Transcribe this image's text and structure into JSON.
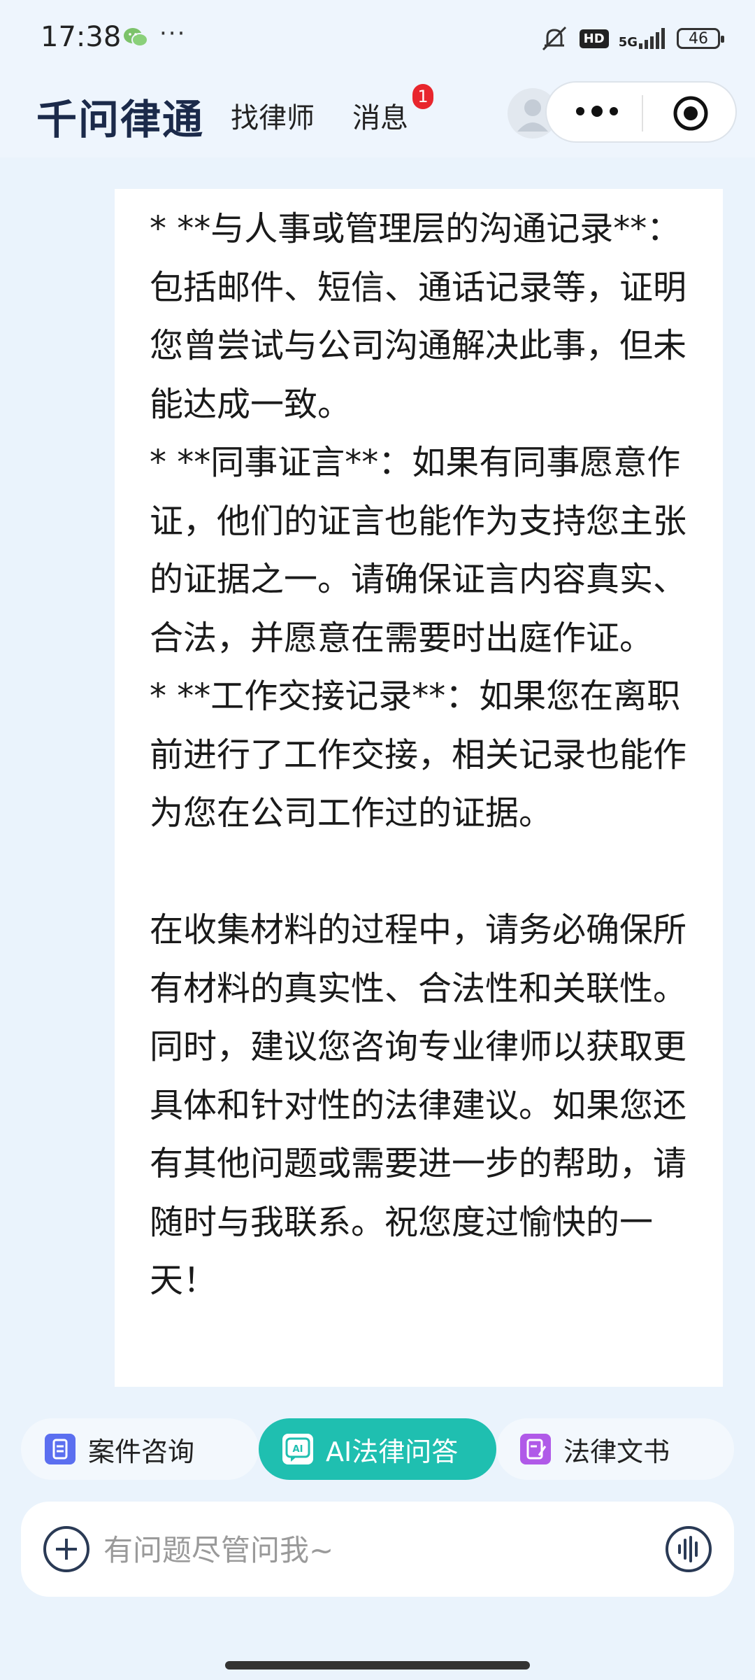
{
  "status_bar": {
    "time": "17:38",
    "dots": "···",
    "hd": "HD",
    "network": "5G",
    "battery": "46"
  },
  "header": {
    "brand": "千问律通",
    "nav": {
      "find_lawyer": "找律师",
      "messages": "消息"
    },
    "message_badge": "1"
  },
  "message": {
    "paragraphs": [
      "* **与人事或管理层的沟通记录**：包括邮件、短信、通话记录等，证明您曾尝试与公司沟通解决此事，但未能达成一致。",
      "* **同事证言**：如果有同事愿意作证，他们的证言也能作为支持您主张的证据之一。请确保证言内容真实、合法，并愿意在需要时出庭作证。",
      "* **工作交接记录**：如果您在离职前进行了工作交接，相关记录也能作为您在公司工作过的证据。",
      "在收集材料的过程中，请务必确保所有材料的真实性、合法性和关联性。同时，建议您咨询专业律师以获取更具体和针对性的法律建议。如果您还有其他问题或需要进一步的帮助，请随时与我联系。祝您度过愉快的一天！"
    ]
  },
  "tabs": [
    {
      "label": "案件咨询",
      "icon": "case-doc-icon",
      "active": false
    },
    {
      "label": "AI法律问答",
      "icon": "ai-chat-icon",
      "active": true
    },
    {
      "label": "法律文书",
      "icon": "legal-doc-icon",
      "active": false
    }
  ],
  "input": {
    "placeholder": "有问题尽管问我~",
    "value": ""
  },
  "colors": {
    "accent": "#1fbfb0",
    "badge": "#e8262d",
    "brand": "#1b2a4a"
  }
}
